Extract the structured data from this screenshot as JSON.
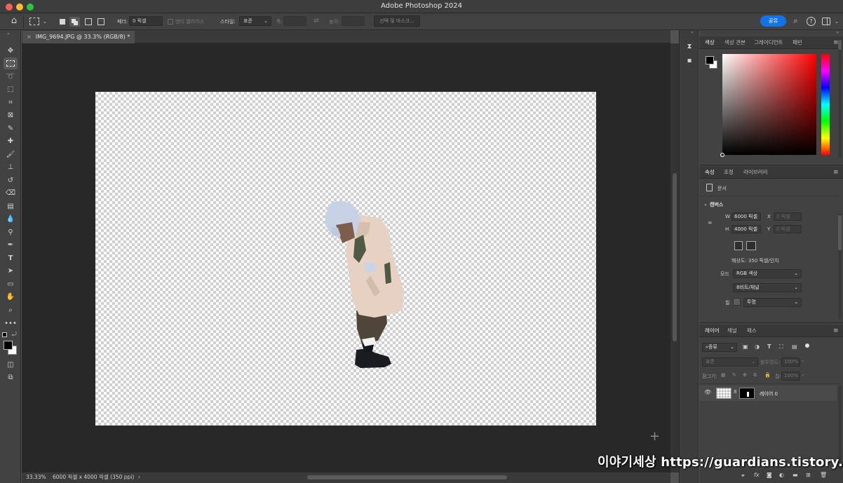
{
  "app_title": "Adobe Photoshop 2024",
  "options_bar": {
    "feather_label": "페더:",
    "feather_value": "0 픽셀",
    "antialias_label": "앤티 앨리어스",
    "style_label": "스타일:",
    "style_value": "표준",
    "width_label": "폭:",
    "height_label": "높이:",
    "select_mask_label": "선택 및 마스크...",
    "share_label": "공유"
  },
  "document_tab": {
    "label": "IMG_9694.JPG @ 33.3% (RGB/8) *",
    "close": "×"
  },
  "status_bar": {
    "zoom": "33.33%",
    "doc_info": "6000 픽셀 x 4000 픽셀 (350 ppi)",
    "arrow": "›"
  },
  "color_panel": {
    "tabs": [
      "색상",
      "색상 견본",
      "그레이디언트",
      "패턴"
    ]
  },
  "properties_panel": {
    "tabs": [
      "속성",
      "조정",
      "라이브러리"
    ],
    "doc_label": "문서",
    "section": "캔버스",
    "w_label": "W",
    "w_value": "6000 픽셀",
    "h_label": "H",
    "h_value": "4000 픽셀",
    "x_label": "X",
    "x_placeholder": "0 픽셀",
    "y_label": "Y",
    "y_placeholder": "0 픽셀",
    "resolution": "해상도: 350 픽셀/인치",
    "mode_label": "모드",
    "mode_value": "RGB 색상",
    "depth_value": "8비트/채널",
    "fill_label": "칠",
    "fill_value": "투명"
  },
  "layers_panel": {
    "tabs": [
      "레이어",
      "채널",
      "패스"
    ],
    "filter_kind": "종류",
    "blend_mode": "표준",
    "opacity_label": "불투명도:",
    "opacity_value": "100%",
    "lock_label": "잠그기:",
    "fill_label": "칠:",
    "fill_value": "100%",
    "layers": [
      {
        "name": "레이어 0"
      }
    ],
    "footer_icons": [
      "link-icon",
      "fx-icon",
      "mask-icon",
      "adjustment-icon",
      "group-icon",
      "new-layer-icon",
      "trash-icon"
    ]
  },
  "watermark": "이야기세상 https://guardians.tistory.com",
  "colors": {
    "accent": "#1473e6",
    "foreground": "#000000",
    "background": "#ffffff"
  }
}
